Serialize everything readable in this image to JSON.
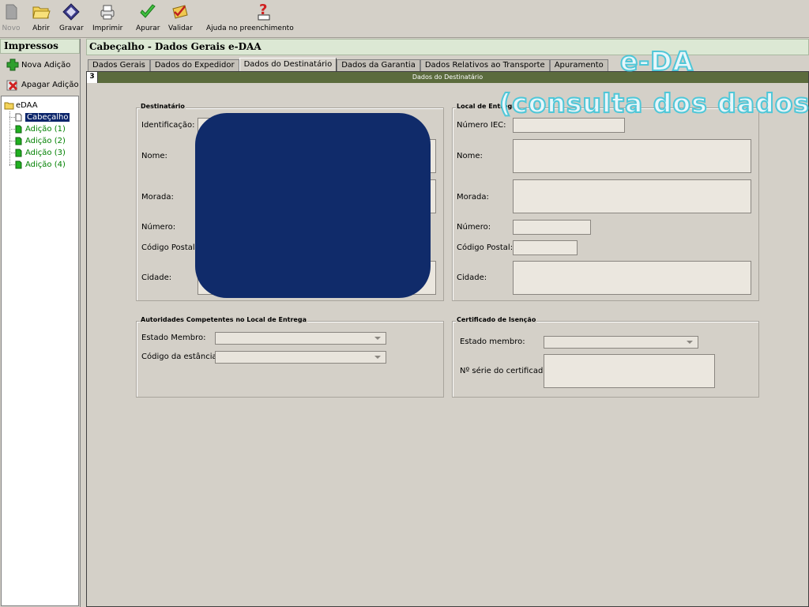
{
  "toolbar": {
    "novo": "Novo",
    "abrir": "Abrir",
    "gravar": "Gravar",
    "imprimir": "Imprimir",
    "apurar": "Apurar",
    "validar": "Validar",
    "ajuda": "Ajuda no preenchimento"
  },
  "sidebar": {
    "title": "Impressos",
    "nova_adicao": "Nova Adição",
    "apagar_adicao": "Apagar Adição",
    "tree": {
      "root": "eDAA",
      "items": [
        "Cabeçalho",
        "Adição (1)",
        "Adição (2)",
        "Adição (3)",
        "Adição (4)"
      ],
      "selected": "Cabeçalho"
    }
  },
  "main": {
    "header": "Cabeçalho - Dados Gerais e-DAA",
    "tabs": [
      "Dados Gerais",
      "Dados do Expedidor",
      "Dados do Destinatário",
      "Dados da Garantia",
      "Dados Relativos ao Transporte",
      "Apuramento"
    ],
    "active_tab": "Dados do Destinatário",
    "section_number": "3",
    "section_title": "Dados do Destinatário"
  },
  "destinatario": {
    "title": "Destinatário",
    "identificacao": "Identificação:",
    "nome": "Nome:",
    "morada": "Morada:",
    "numero": "Número:",
    "codigo_postal": "Código Postal:",
    "cidade": "Cidade:"
  },
  "local_entrega": {
    "title": "Local de Entrega",
    "numero_iec": "Número IEC:",
    "nome": "Nome:",
    "morada": "Morada:",
    "numero": "Número:",
    "codigo_postal": "Código Postal:",
    "cidade": "Cidade:"
  },
  "autoridades": {
    "title": "Autoridades Competentes no Local de Entrega",
    "estado_membro": "Estado Membro:",
    "codigo_estancia": "Código da estância:"
  },
  "certificado": {
    "title": "Certificado de Isenção",
    "estado_membro": "Estado membro:",
    "n_serie": "Nº série do certificado:"
  },
  "overlay": {
    "title": "e-DA",
    "subtitle": "(consulta dos dados)"
  },
  "colors": {
    "header_bg": "#dce8d4",
    "section_bar": "#5b6b3d",
    "mask": "#102b6a",
    "overlay_text": "#4fc7d8",
    "tree_item": "#008000"
  }
}
